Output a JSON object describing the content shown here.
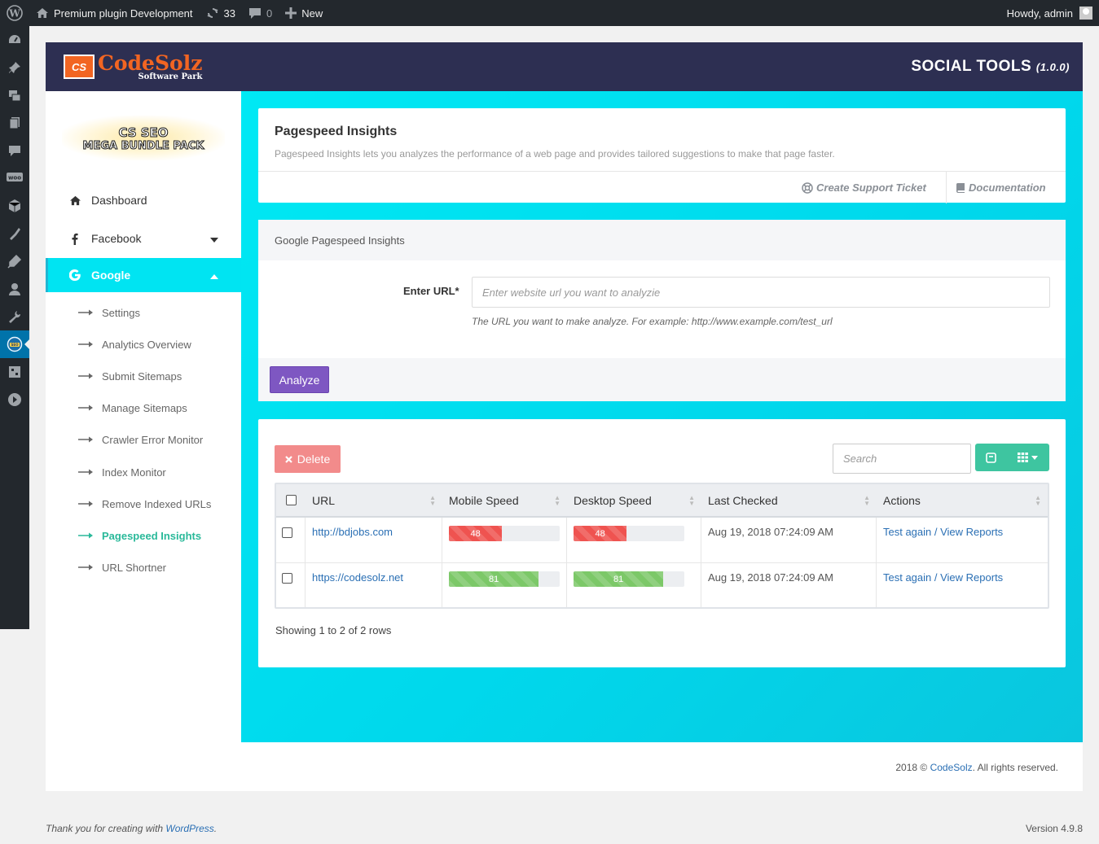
{
  "admin_bar": {
    "site_name": "Premium plugin Development",
    "updates_count": "33",
    "comments_count": "0",
    "new_label": "New",
    "greeting": "Howdy, admin"
  },
  "header": {
    "logo_name_a": "Code",
    "logo_name_b": "Solz",
    "logo_sub": "Software Park",
    "logo_mark": "CS",
    "app_title": "SOCIAL TOOLS",
    "app_version": "(1.0.0)"
  },
  "sidebar": {
    "bundle_line1": "CS SEO",
    "bundle_line2": "MEGA BUNDLE PACK",
    "dashboard": "Dashboard",
    "facebook": "Facebook",
    "google": "Google",
    "submenu": [
      "Settings",
      "Analytics Overview",
      "Submit Sitemaps",
      "Manage Sitemaps",
      "Crawler Error Monitor",
      "Index Monitor",
      "Remove Indexed URLs",
      "Pagespeed Insights",
      "URL Shortner"
    ],
    "active_submenu": "Pagespeed Insights"
  },
  "intro_card": {
    "title": "Pagespeed Insights",
    "description": "Pagespeed Insights lets you analyzes the performance of a web page and provides tailored suggestions to make that page faster.",
    "support_link": "Create Support Ticket",
    "docs_link": "Documentation"
  },
  "form_card": {
    "heading": "Google Pagespeed Insights",
    "url_label": "Enter URL*",
    "url_placeholder": "Enter website url you want to analyzie",
    "url_value": "",
    "help_text": "The URL you want to make analyze. For example: http://www.example.com/test_url",
    "analyze_button": "Analyze"
  },
  "table_card": {
    "delete_button": "Delete",
    "search_placeholder": "Search",
    "columns": [
      "URL",
      "Mobile Speed",
      "Desktop Speed",
      "Last Checked",
      "Actions"
    ],
    "rows": [
      {
        "url": "http://bdjobs.com",
        "mobile_speed": "48",
        "desktop_speed": "48",
        "last_checked": "Aug 19, 2018 07:24:09 AM",
        "action_test": "Test again",
        "action_sep": " / ",
        "action_view": "View Reports",
        "color": "#ef5350"
      },
      {
        "url": "https://codesolz.net",
        "mobile_speed": "81",
        "desktop_speed": "81",
        "last_checked": "Aug 19, 2018 07:24:09 AM",
        "action_test": "Test again",
        "action_sep": " / ",
        "action_view": "View Reports",
        "color": "#7cc868"
      }
    ],
    "showing_text": "Showing 1 to 2 of 2 rows"
  },
  "footer": {
    "copyright_prefix": "2018 © ",
    "copyright_link": "CodeSolz",
    "copyright_suffix": ". All rights reserved.",
    "wp_thanks_prefix": "Thank you for creating with ",
    "wp_link": "WordPress",
    "wp_thanks_suffix": ".",
    "version": "Version 4.9.8"
  },
  "colors": {
    "accent_cyan": "#00e4f2",
    "header_navy": "#2d2f52",
    "brand_orange": "#f26522",
    "analyze_purple": "#7e57c2",
    "active_green": "#2ab99a"
  }
}
